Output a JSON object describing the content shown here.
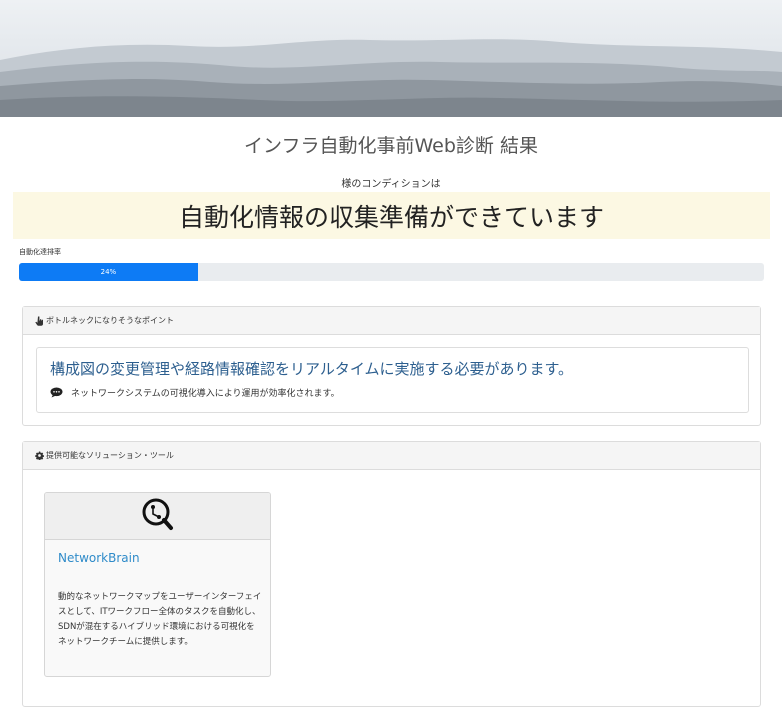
{
  "hero": {
    "sky_color": "#e4e9ee"
  },
  "page": {
    "title": "インフラ自動化事前Web診断 結果",
    "condition_label": "様のコンディションは",
    "condition_result": "自動化情報の収集準備ができています"
  },
  "progress": {
    "label": "自動化達排率",
    "value_text": "24%",
    "value": 0.24,
    "color": "#0d7bf5"
  },
  "bottleneck": {
    "header_icon": "hand-pointer-icon",
    "header": "ボトルネックになりそうなポイント",
    "title": "構成図の変更管理や経路情報確認をリアルタイムに実施する必要があります。",
    "sub_icon": "comment-icon",
    "sub": "ネットワークシステムの可視化導入により運用が効率化されます。"
  },
  "solutions": {
    "header_icon": "gear-icon",
    "header": "提供可能なソリューション・ツール",
    "tools": [
      {
        "icon": "networkbrain-logo-icon",
        "name": "NetworkBrain",
        "description": "動的なネットワークマップをユーザーインターフェイスとして、ITワークフロー全体のタスクを自動化し、SDNが混在するハイブリッド環境における可視化をネットワークチームに提供します。"
      }
    ]
  }
}
